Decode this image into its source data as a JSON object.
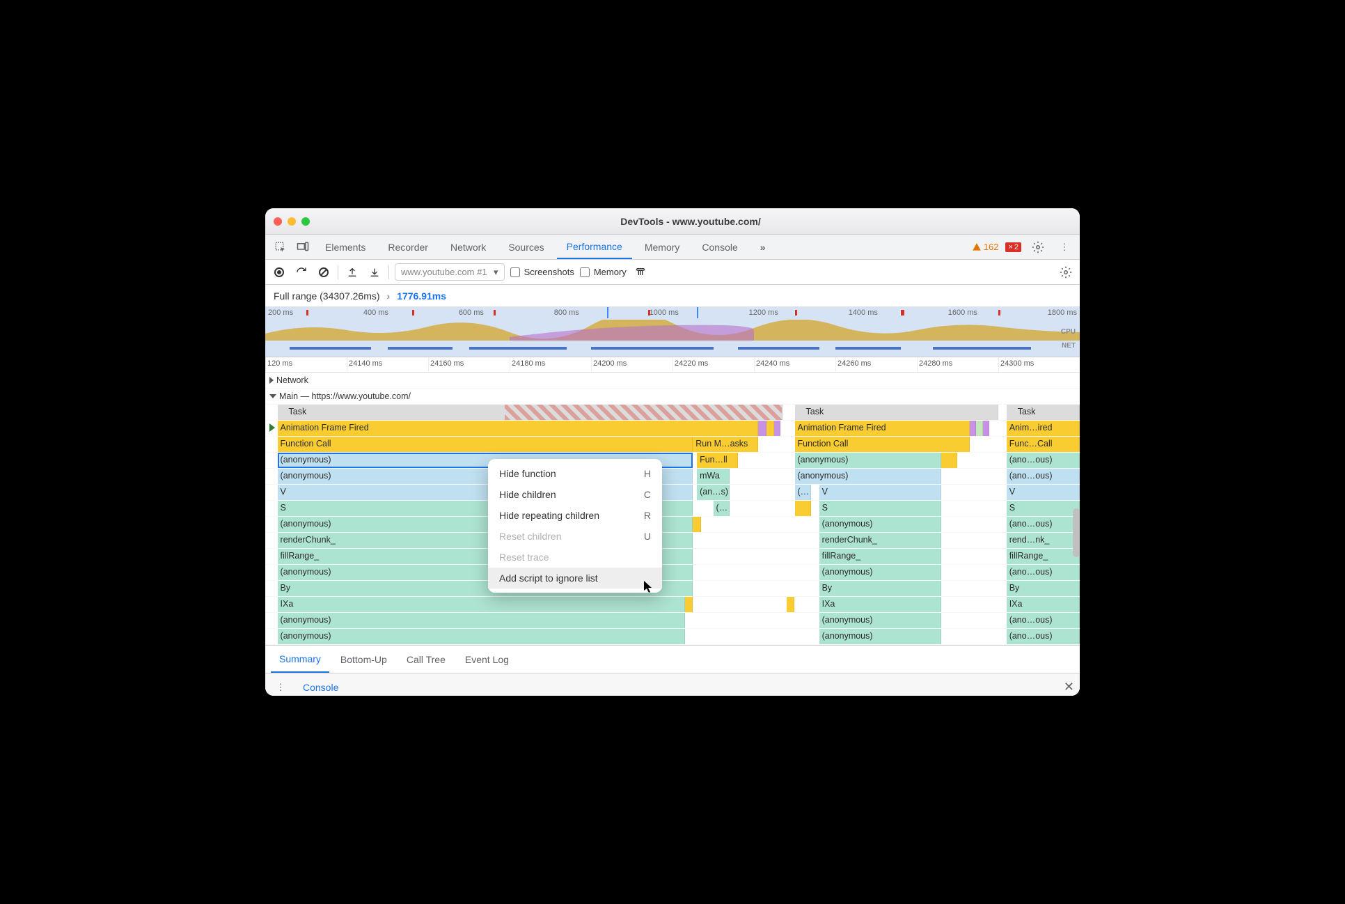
{
  "title": "DevTools - www.youtube.com/",
  "tabs": [
    "Elements",
    "Recorder",
    "Network",
    "Sources",
    "Performance",
    "Memory",
    "Console"
  ],
  "activeTab": "Performance",
  "moreTabs": "»",
  "warnCount": "162",
  "errCount": "2",
  "toolbar": {
    "select": "www.youtube.com #1",
    "screenshots": "Screenshots",
    "memory": "Memory"
  },
  "breadcrumb": {
    "full": "Full range (34307.26ms)",
    "sep": "›",
    "current": "1776.91ms"
  },
  "overviewTicks": [
    "200 ms",
    "400 ms",
    "600 ms",
    "800 ms",
    "1000 ms",
    "1200 ms",
    "1400 ms",
    "1600 ms",
    "1800 ms"
  ],
  "overviewLabels": {
    "cpu": "CPU",
    "net": "NET"
  },
  "rulerTicks": [
    "120 ms",
    "24140 ms",
    "24160 ms",
    "24180 ms",
    "24200 ms",
    "24220 ms",
    "24240 ms",
    "24260 ms",
    "24280 ms",
    "24300 ms"
  ],
  "tracks": {
    "network": "Network",
    "main": "Main — https://www.youtube.com/"
  },
  "flame": {
    "task": "Task",
    "aff": "Animation Frame Fired",
    "aff3": "Anim…ired",
    "fc": "Function Call",
    "fc3": "Func…Call",
    "runm": "Run M…asks",
    "anon": "(anonymous)",
    "anon_s": "(ano…ous)",
    "funll": "Fun…ll",
    "mwa": "mWa",
    "ans": "(an…s)",
    "paren": "(…",
    "v": "V",
    "s": "S",
    "renderchunk": "renderChunk_",
    "renderchunk_s": "rend…nk_",
    "fillrange": "fillRange_",
    "by": "By",
    "ixa": "IXa"
  },
  "contextMenu": [
    {
      "label": "Hide function",
      "key": "H",
      "disabled": false
    },
    {
      "label": "Hide children",
      "key": "C",
      "disabled": false
    },
    {
      "label": "Hide repeating children",
      "key": "R",
      "disabled": false
    },
    {
      "label": "Reset children",
      "key": "U",
      "disabled": true
    },
    {
      "label": "Reset trace",
      "key": "",
      "disabled": true
    },
    {
      "label": "Add script to ignore list",
      "key": "",
      "disabled": false,
      "hover": true
    }
  ],
  "bottomTabs": [
    "Summary",
    "Bottom-Up",
    "Call Tree",
    "Event Log"
  ],
  "activeBottomTab": "Summary",
  "drawer": "Console"
}
